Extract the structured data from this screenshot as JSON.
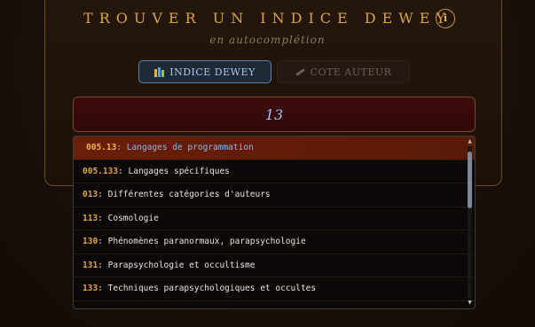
{
  "header": {
    "title": "TROUVER UN INDICE DEWEY",
    "subtitle": "en autocomplétion",
    "info_label": "i"
  },
  "tabs": [
    {
      "label": "INDICE DEWEY",
      "icon": "books-icon",
      "active": true
    },
    {
      "label": "COTE AUTEUR",
      "icon": "pencil-icon",
      "active": false
    }
  ],
  "search": {
    "value": "13"
  },
  "results": [
    {
      "code": "005.13",
      "label": "Langages de programmation"
    },
    {
      "code": "005.133",
      "label": "Langages spécifiques"
    },
    {
      "code": "013",
      "label": "Différentes catégories d'auteurs"
    },
    {
      "code": "113",
      "label": "Cosmologie"
    },
    {
      "code": "130",
      "label": "Phénomènes paranormaux, parapsychologie"
    },
    {
      "code": "131",
      "label": "Parapsychologie et occultisme"
    },
    {
      "code": "133",
      "label": "Techniques parapsychologiques et occultes"
    }
  ],
  "colors": {
    "accent_gold": "#d9a441",
    "active_tab_text": "#a9c7ea",
    "highlight_row": "#6b1e08"
  }
}
